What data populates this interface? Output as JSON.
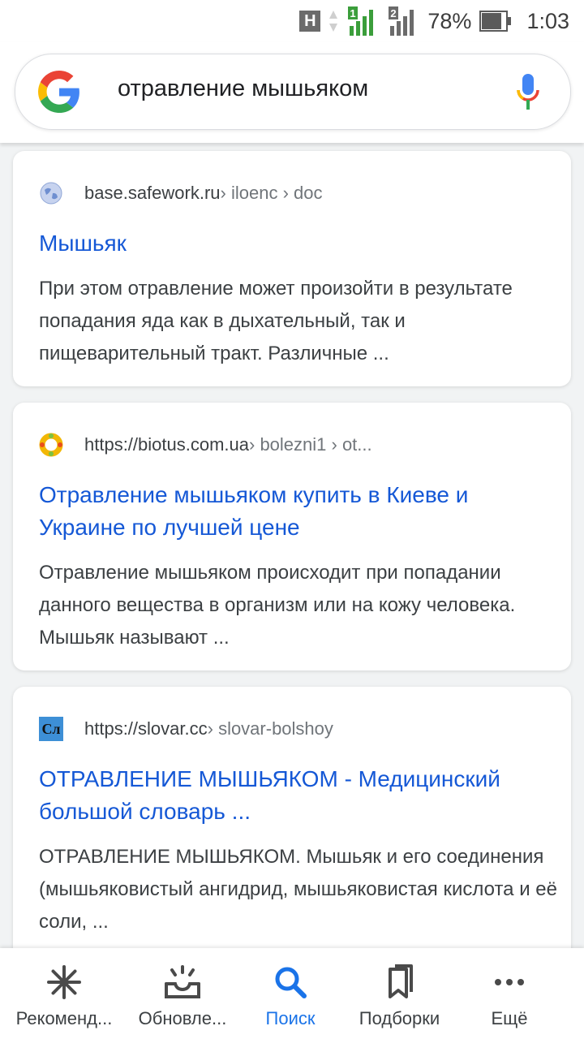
{
  "status_bar": {
    "network_badge": "H",
    "sim1_label": "1",
    "sim2_label": "2",
    "battery_percent": "78%",
    "time": "1:03"
  },
  "search": {
    "query": "отравление мышьяком"
  },
  "results": [
    {
      "site": "base.safework.ru",
      "path": " › iloenc › doc",
      "title": "Мышьяк",
      "snippet": "При этом отравление может произойти в результате попадания яда как в дыхательный, так и пищеварительный тракт. Различные ..."
    },
    {
      "site": "https://biotus.com.ua",
      "path": " › bolezni1 › ot...",
      "title": "Отравление мышьяком купить в Киеве и Украине по лучшей цене",
      "snippet": "Отравление мышьяком происходит при попадании данного вещества в организм или на кожу человека. Мышьяк называют ..."
    },
    {
      "site": "https://slovar.cc",
      "path": " › slovar-bolshoy",
      "favicon_text": "Сл",
      "title": "ОТРАВЛЕНИЕ МЫШЬЯКОМ - Медицинский большой словарь ...",
      "snippet": "ОТРАВЛЕНИЕ МЫШЬЯКОМ. Мышьяк и его соединения (мышьяковистый ангидрид, мышьяковистая кислота и её соли, ..."
    }
  ],
  "bottom_nav": [
    {
      "label": "Рекоменд...",
      "icon": "asterisk-icon"
    },
    {
      "label": "Обновле...",
      "icon": "updates-inbox-icon"
    },
    {
      "label": "Поиск",
      "icon": "search-icon"
    },
    {
      "label": "Подборки",
      "icon": "collections-bookmark-icon"
    },
    {
      "label": "Ещё",
      "icon": "more-dots-icon"
    }
  ],
  "colors": {
    "link": "#1558d6",
    "active_nav": "#1a73e8"
  }
}
